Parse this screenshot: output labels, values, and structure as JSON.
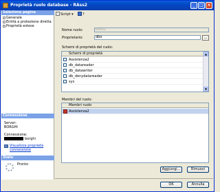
{
  "window": {
    "title": "Proprietà ruolo database - RAss2"
  },
  "left_pane": {
    "pages_header": "Seleziona pagina",
    "pages": [
      {
        "label": "Generale"
      },
      {
        "label": "Entità a protezione diretta"
      },
      {
        "label": "Proprietà estese"
      }
    ],
    "connection_header": "Connessione",
    "server_label": "Server:",
    "server_value": "BORGHI",
    "connection_label": "Connessione:",
    "connection_value": "borghi",
    "view_props_link_line1": "Visualizza proprietà",
    "view_props_link_line2": "connessione",
    "status_header": "Stato",
    "status_value": "Pronto"
  },
  "toolbar": {
    "script_label": "Script",
    "help_label": "?"
  },
  "form": {
    "role_name_label": "Nome ruolo:",
    "role_name_value": "RAss2",
    "owner_label": "Proprietario:",
    "owner_value": "dbo",
    "ellipsis_label": "..."
  },
  "owned_schemas": {
    "section_label": "Schemi di proprietà del ruolo:",
    "column_header": "Schemi di proprietà",
    "rows": [
      {
        "label": "Assistenza2",
        "checked": false
      },
      {
        "label": "db_datareader",
        "checked": false
      },
      {
        "label": "db_datawriter",
        "checked": false
      },
      {
        "label": "db_denydatareader",
        "checked": false
      },
      {
        "label": "sys",
        "checked": false
      }
    ]
  },
  "role_members": {
    "section_label": "Membri del ruolo:",
    "column_header": "Membri ruolo",
    "rows": [
      {
        "label": "Assistenza2"
      }
    ]
  },
  "buttons": {
    "add": "Aggiungi...",
    "remove": "Rimuovi",
    "ok": "OK",
    "cancel": "Annulla"
  },
  "colors": {
    "title_bar": "#0447c4",
    "section_header": "#7ba2e7",
    "selection": "#c1d2ee"
  }
}
